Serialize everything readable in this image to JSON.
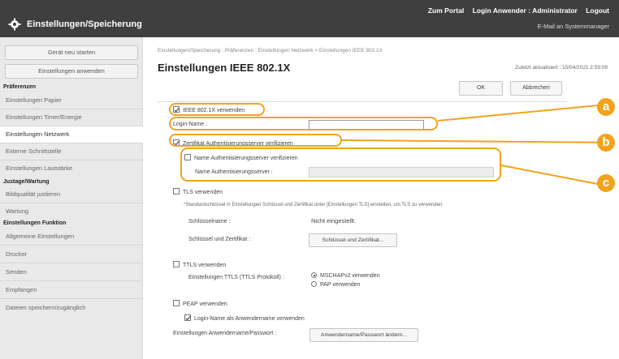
{
  "header": {
    "app_title": "Einstellungen/Speicherung",
    "links": [
      "Zum Portal",
      "Login Anwender : Administrator",
      "Logout"
    ],
    "mail_admin": "E-Mail an Systemmanager"
  },
  "sidebar": {
    "restart_button": "Gerät neu starten",
    "apply_button": "Einstellungen anwenden",
    "section_preferences": "Präferenzen",
    "items_preferences": [
      "Einstellungen Papier",
      "Einstellungen Timer/Energie",
      "Einstellungen Netzwerk",
      "Externe Schnittstelle",
      "Einstellungen Lautstärke"
    ],
    "section_adjust": "Justage/Wartung",
    "items_adjust": [
      "Bildqualität justieren",
      "Wartung"
    ],
    "section_functions": "Einstellungen Funktion",
    "items_functions": [
      "Allgemeine Einstellungen",
      "Drucker",
      "Senden",
      "Empfangen",
      "Dateien speichern/zugänglich"
    ]
  },
  "main": {
    "breadcrumb": "Einstellungen/Speicherung : Präferenzen : Einstellungen Netzwerk > Einstellungen IEEE 802.1X",
    "title": "Einstellungen IEEE 802.1X",
    "last_updated": "Zuletzt aktualisiert : 15/04/2021 2:59:09",
    "ok_button": "OK",
    "cancel_button": "Abbrechen",
    "use_ieee": "IEEE 802.1X verwenden",
    "login_name_label": "Login-Name :",
    "login_name_value": "",
    "verify_cert": "Zertifikat Authentisierungsserver verifizieren",
    "verify_name": "Name Authentisierungsserver verifizieren",
    "server_name_label": "Name Authentisierungsserver :",
    "server_name_value": "",
    "use_tls": "TLS verwenden",
    "tls_note": "*Standardschlüssel in Einstellungen Schlüssel und Zertifikat unter [Einstellungen TLS] einstellen, um TLS zu verwenden.",
    "key_name_label": "Schlüsselname :",
    "key_name_value": "Nicht eingestellt.",
    "key_cert_label": "Schlüssel und Zertifikat :",
    "key_cert_button": "Schlüssel und Zertifikat...",
    "use_ttls": "TTLS verwenden",
    "ttls_setting_label": "Einstellungen TTLS (TTLS Protokoll) :",
    "ttls_opt1": "MSCHAPv2 verwenden",
    "ttls_opt2": "PAP verwenden",
    "use_peap": "PEAP verwenden",
    "login_as_user": "Login-Name als Anwendername verwenden",
    "user_pw_label": "Einstellungen Anwendername/Passwort :",
    "user_pw_button": "Anwendername/Passwort ändern..."
  },
  "callouts": [
    "a",
    "b",
    "c"
  ],
  "colors": {
    "accent": "#f2a31b",
    "header_bg": "#3f3f3f",
    "sidebar_bg": "#e9e9e9"
  }
}
